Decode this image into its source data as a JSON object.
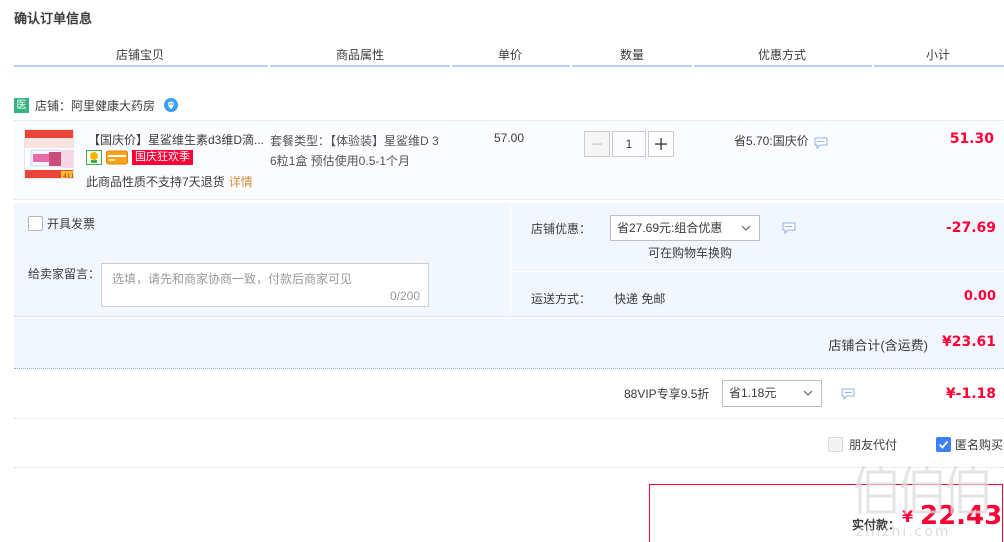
{
  "page": {
    "title": "确认订单信息"
  },
  "columns": [
    "店铺宝贝",
    "商品属性",
    "单价",
    "数量",
    "优惠方式",
    "小计"
  ],
  "shop": {
    "badge": "医",
    "label": "店铺：阿里健康大药房"
  },
  "item": {
    "title": "【国庆价】星鲨维生素d3维D滴...",
    "promo_tag": "国庆狂欢季",
    "return_note": "此商品性质不支持7天退货",
    "detail_link": "详情",
    "attr_line1": "套餐类型：【体验装】星鲨维D 3",
    "attr_line2": "6粒1盒 预估使用0.5-1个月",
    "unit_price": "57.00",
    "quantity": "1",
    "discount": "省5.70:国庆价",
    "subtotal": "51.30",
    "thumb_text": "411"
  },
  "options": {
    "invoice_label": "开具发票",
    "message_label": "给卖家留言：",
    "message_placeholder": "选填，请先和商家协商一致，付款后商家可见",
    "message_counter": "0/200",
    "shop_promo_label": "店铺优惠：",
    "shop_promo_value": "省27.69元:组合优惠",
    "shop_promo_note": "可在购物车换购",
    "shop_promo_amount": "-27.69",
    "shipping_label": "运送方式：",
    "shipping_value": "快递 免邮",
    "shipping_amount": "0.00"
  },
  "shop_total": {
    "label": "店铺合计(含运费)",
    "value": "¥23.61"
  },
  "vip": {
    "label": "88VIP专享9.5折",
    "select_value": "省1.18元",
    "amount": "¥-1.18"
  },
  "pay_options": {
    "friend_pay": "朋友代付",
    "anonymous_buy": "匿名购买",
    "anonymous_checked": true
  },
  "payment": {
    "label": "实付款：",
    "currency": "¥",
    "amount": "22.43"
  },
  "watermark": {
    "chars": "值值值",
    "domain": "zhizhi.com"
  },
  "colors": {
    "accent_red": "#ff0036",
    "header_line": "#b2d1ff",
    "panel_bg": "#f2f7ff",
    "checkbox_blue": "#3d7ff6"
  }
}
